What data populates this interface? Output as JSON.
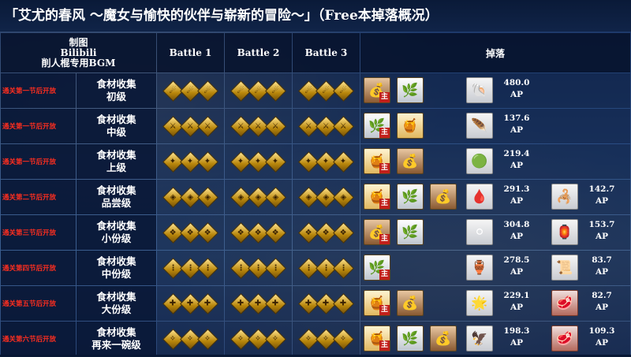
{
  "title": "「艾尤的春风 ～魔女与愉快的伙伴与崭新的冒险～」（Free本掉落概况）",
  "header": {
    "credit": [
      "制图",
      "Bilibili",
      "削人棍专用BGM"
    ],
    "battle1": "Battle 1",
    "battle2": "Battle 2",
    "battle3": "Battle 3",
    "drops": "掉落"
  },
  "ap_unit": "AP",
  "main_tag": "主",
  "rows": [
    {
      "unlock": "通关第一节后开放",
      "quest": [
        "食材收集",
        "初级"
      ],
      "class_icon": "☄",
      "enemies": [
        3,
        3,
        3
      ],
      "drops": [
        {
          "icon": "sack-icon",
          "glyph": "💰",
          "style": "bronze",
          "main": true
        },
        {
          "icon": "herb-icon",
          "glyph": "🌿",
          "style": "silver"
        }
      ],
      "mats": [
        {
          "icon": "shell-icon",
          "glyph": "🐚",
          "style": "mat",
          "ap": "480.0"
        }
      ]
    },
    {
      "unlock": "通关第一节后开放",
      "quest": [
        "食材收集",
        "中级"
      ],
      "class_icon": "⚔",
      "enemies": [
        3,
        3,
        3
      ],
      "drops": [
        {
          "icon": "herb-icon",
          "glyph": "🌿",
          "style": "silver",
          "main": true
        },
        {
          "icon": "jar-icon",
          "glyph": "🍯",
          "style": "gold"
        }
      ],
      "mats": [
        {
          "icon": "feather-icon",
          "glyph": "🪶",
          "style": "mat",
          "ap": "137.6"
        }
      ]
    },
    {
      "unlock": "通关第一节后开放",
      "quest": [
        "食材收集",
        "上级"
      ],
      "class_icon": "✦",
      "enemies": [
        3,
        3,
        3
      ],
      "drops": [
        {
          "icon": "jar-icon",
          "glyph": "🍯",
          "style": "gold",
          "main": true
        },
        {
          "icon": "sack-icon",
          "glyph": "💰",
          "style": "bronze"
        }
      ],
      "mats": [
        {
          "icon": "gem-icon",
          "glyph": "🟢",
          "style": "mat",
          "ap": "219.4"
        }
      ]
    },
    {
      "unlock": "通关第二节后开放",
      "quest": [
        "食材收集",
        "品尝级"
      ],
      "class_icon": "◈",
      "enemies": [
        3,
        3,
        3
      ],
      "drops": [
        {
          "icon": "jar-icon",
          "glyph": "🍯",
          "style": "gold",
          "main": true
        },
        {
          "icon": "herb-icon",
          "glyph": "🌿",
          "style": "silver"
        },
        {
          "icon": "sack-icon",
          "glyph": "💰",
          "style": "bronze"
        }
      ],
      "mats": [
        {
          "icon": "blood-drop-icon",
          "glyph": "🩸",
          "style": "mat",
          "ap": "291.3"
        },
        {
          "icon": "claw-icon",
          "glyph": "🦂",
          "style": "mat",
          "ap": "142.7"
        }
      ]
    },
    {
      "unlock": "通关第三节后开放",
      "quest": [
        "食材收集",
        "小份级"
      ],
      "class_icon": "❖",
      "enemies": [
        3,
        3,
        3
      ],
      "drops": [
        {
          "icon": "sack-icon",
          "glyph": "💰",
          "style": "bronze",
          "main": true
        },
        {
          "icon": "herb-icon",
          "glyph": "🌿",
          "style": "silver"
        }
      ],
      "mats": [
        {
          "icon": "pearl-icon",
          "glyph": "⚪",
          "style": "mat",
          "ap": "304.8"
        },
        {
          "icon": "lantern-icon",
          "glyph": "🏮",
          "style": "mat",
          "ap": "153.7"
        }
      ]
    },
    {
      "unlock": "通关第四节后开放",
      "quest": [
        "食材收集",
        "中份级"
      ],
      "class_icon": "⋮",
      "enemies": [
        3,
        3,
        3
      ],
      "drops": [
        {
          "icon": "herb-icon",
          "glyph": "🌿",
          "style": "silver",
          "main": true
        }
      ],
      "mats": [
        {
          "icon": "chalice-icon",
          "glyph": "🏺",
          "style": "mat",
          "ap": "278.5"
        },
        {
          "icon": "scroll-icon",
          "glyph": "📜",
          "style": "mat",
          "ap": "83.7"
        }
      ]
    },
    {
      "unlock": "通关第五节后开放",
      "quest": [
        "食材收集",
        "大份级"
      ],
      "class_icon": "✚",
      "enemies": [
        3,
        3,
        3
      ],
      "drops": [
        {
          "icon": "jar-icon",
          "glyph": "🍯",
          "style": "gold",
          "main": true
        },
        {
          "icon": "sack-icon",
          "glyph": "💰",
          "style": "bronze"
        }
      ],
      "mats": [
        {
          "icon": "star-core-icon",
          "glyph": "🌟",
          "style": "mat",
          "ap": "229.1"
        },
        {
          "icon": "meat-icon",
          "glyph": "🥩",
          "style": "mat2",
          "ap": "82.7"
        }
      ]
    },
    {
      "unlock": "通关第六节后开放",
      "quest": [
        "食材收集",
        "再来一碗级"
      ],
      "class_icon": "✧",
      "enemies": [
        3,
        3,
        3
      ],
      "drops": [
        {
          "icon": "jar-icon",
          "glyph": "🍯",
          "style": "gold",
          "main": true
        },
        {
          "icon": "herb-icon",
          "glyph": "🌿",
          "style": "silver"
        },
        {
          "icon": "sack-icon",
          "glyph": "💰",
          "style": "bronze"
        }
      ],
      "mats": [
        {
          "icon": "wing-icon",
          "glyph": "🦅",
          "style": "mat",
          "ap": "198.3"
        },
        {
          "icon": "meat-icon",
          "glyph": "🥩",
          "style": "mat2",
          "ap": "109.3"
        }
      ]
    }
  ]
}
